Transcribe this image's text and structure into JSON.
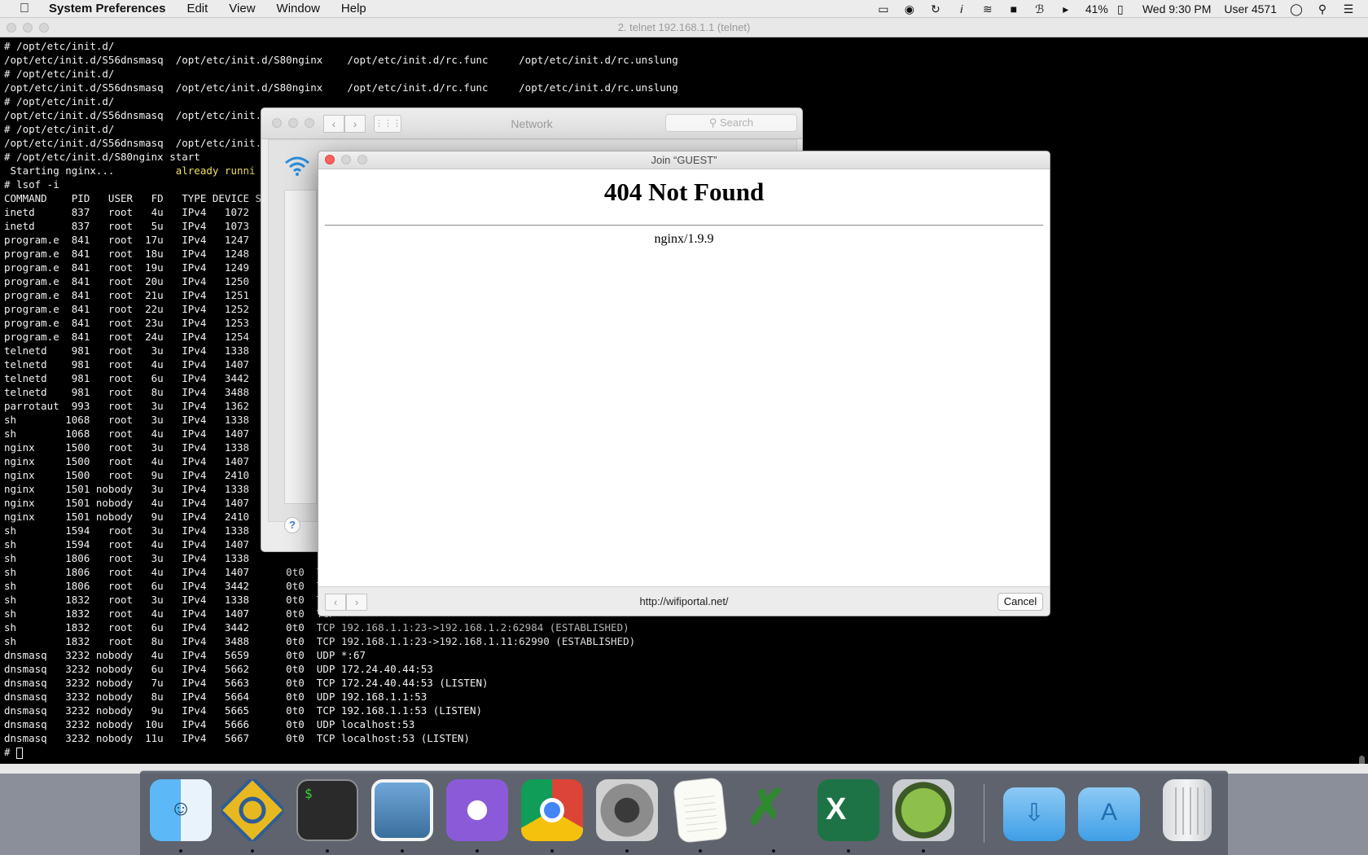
{
  "menubar": {
    "app": "System Preferences",
    "menus": [
      "Edit",
      "View",
      "Window",
      "Help"
    ],
    "battery": "41%",
    "clock": "Wed 9:30 PM",
    "user": "User 4571",
    "status_icons": [
      "airplay-icon",
      "hangouts-icon",
      "sync-icon",
      "info-icon",
      "wifi-icon",
      "lock-icon",
      "bluetooth-icon",
      "volume-icon",
      "battery-icon",
      "user-icon",
      "spotlight-icon",
      "notification-center-icon"
    ]
  },
  "terminal": {
    "title": "2. telnet 192.168.1.1 (telnet)",
    "lines": [
      "# /opt/etc/init.d/",
      "/opt/etc/init.d/S56dnsmasq  /opt/etc/init.d/S80nginx    /opt/etc/init.d/rc.func     /opt/etc/init.d/rc.unslung",
      "# /opt/etc/init.d/",
      "/opt/etc/init.d/S56dnsmasq  /opt/etc/init.d/S80nginx    /opt/etc/init.d/rc.func     /opt/etc/init.d/rc.unslung",
      "# /opt/etc/init.d/",
      "/opt/etc/init.d/S56dnsmasq  /opt/etc/init.d/S",
      "# /opt/etc/init.d/",
      "/opt/etc/init.d/S56dnsmasq  /opt/etc/init.d/S",
      "# /opt/etc/init.d/S80nginx start",
      " Starting nginx...          ",
      "# lsof -i",
      "COMMAND    PID   USER   FD   TYPE DEVICE SIZE",
      "inetd      837   root   4u   IPv4   1072",
      "inetd      837   root   5u   IPv4   1073",
      "program.e  841   root  17u   IPv4   1247",
      "program.e  841   root  18u   IPv4   1248",
      "program.e  841   root  19u   IPv4   1249",
      "program.e  841   root  20u   IPv4   1250",
      "program.e  841   root  21u   IPv4   1251",
      "program.e  841   root  22u   IPv4   1252",
      "program.e  841   root  23u   IPv4   1253",
      "program.e  841   root  24u   IPv4   1254",
      "telnetd    981   root   3u   IPv4   1338",
      "telnetd    981   root   4u   IPv4   1407",
      "telnetd    981   root   6u   IPv4   3442",
      "telnetd    981   root   8u   IPv4   3488",
      "parrotaut  993   root   3u   IPv4   1362",
      "sh        1068   root   3u   IPv4   1338",
      "sh        1068   root   4u   IPv4   1407",
      "nginx     1500   root   3u   IPv4   1338",
      "nginx     1500   root   4u   IPv4   1407",
      "nginx     1500   root   9u   IPv4   2410",
      "nginx     1501 nobody   3u   IPv4   1338",
      "nginx     1501 nobody   4u   IPv4   1407",
      "nginx     1501 nobody   9u   IPv4   2410",
      "sh        1594   root   3u   IPv4   1338",
      "sh        1594   root   4u   IPv4   1407",
      "sh        1806   root   3u   IPv4   1338",
      "sh        1806   root   4u   IPv4   1407      0t0  TCP",
      "sh        1806   root   6u   IPv4   3442      0t0  TCP",
      "sh        1832   root   3u   IPv4   1338      0t0  TCP",
      "sh        1832   root   4u   IPv4   1407      0t0  TCP",
      "sh        1832   root   6u   IPv4   3442      0t0  TCP 192.168.1.1:23->192.168.1.2:62984 (ESTABLISHED)",
      "sh        1832   root   8u   IPv4   3488      0t0  TCP 192.168.1.1:23->192.168.1.11:62990 (ESTABLISHED)",
      "dnsmasq   3232 nobody   4u   IPv4   5659      0t0  UDP *:67",
      "dnsmasq   3232 nobody   6u   IPv4   5662      0t0  UDP 172.24.40.44:53",
      "dnsmasq   3232 nobody   7u   IPv4   5663      0t0  TCP 172.24.40.44:53 (LISTEN)",
      "dnsmasq   3232 nobody   8u   IPv4   5664      0t0  UDP 192.168.1.1:53",
      "dnsmasq   3232 nobody   9u   IPv4   5665      0t0  TCP 192.168.1.1:53 (LISTEN)",
      "dnsmasq   3232 nobody  10u   IPv4   5666      0t0  UDP localhost:53",
      "dnsmasq   3232 nobody  11u   IPv4   5667      0t0  TCP localhost:53 (LISTEN)"
    ],
    "highlight": "already runni",
    "prompt": "# "
  },
  "network_window": {
    "title": "Network",
    "search_placeholder": "Search",
    "help_label": "?"
  },
  "join_window": {
    "title": "Join “GUEST”",
    "heading": "404 Not Found",
    "server": "nginx/1.9.9",
    "url": "http://wifiportal.net/",
    "cancel_label": "Cancel"
  },
  "dock": {
    "apps": [
      "finder",
      "telnet-app",
      "terminal",
      "preview",
      "textual",
      "chrome",
      "system-preferences",
      "textedit",
      "keys",
      "excel",
      "time-machine",
      "downloads",
      "applications",
      "trash"
    ],
    "terminal_glyph": "$"
  }
}
